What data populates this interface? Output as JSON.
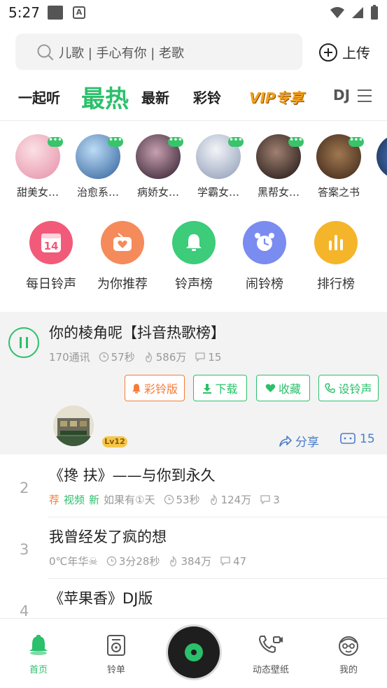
{
  "status_bar": {
    "time": "5:27"
  },
  "search": {
    "placeholder": "儿歌 | 手心有你 | 老歌",
    "upload_label": "上传"
  },
  "tabs": [
    "一起听",
    "最热",
    "最新",
    "彩铃",
    "VIP专享",
    "DJ"
  ],
  "active_tab": "最热",
  "avatars": [
    {
      "label": "甜美女…",
      "color": "#f2b8c6"
    },
    {
      "label": "治愈系…",
      "color": "#6fa8dc"
    },
    {
      "label": "病娇女…",
      "color": "#4a3a5a"
    },
    {
      "label": "学霸女…",
      "color": "#c9d3e6"
    },
    {
      "label": "黑帮女…",
      "color": "#3a2a2a"
    },
    {
      "label": "答案之书",
      "color": "#6a4a3a"
    }
  ],
  "categories": [
    {
      "label": "每日铃声",
      "icon": "calendar-icon",
      "color": "#f25a7a",
      "badge": "14"
    },
    {
      "label": "为你推荐",
      "icon": "heart-radio-icon",
      "color": "#f58a5a"
    },
    {
      "label": "铃声榜",
      "icon": "bell-icon",
      "color": "#3ccc7a"
    },
    {
      "label": "闹铃榜",
      "icon": "alarm-clock-icon",
      "color": "#7a8cf0"
    },
    {
      "label": "排行榜",
      "icon": "bar-chart-icon",
      "color": "#f5b52a"
    }
  ],
  "playing": {
    "title": "你的棱角呢【抖音热歌榜】",
    "author": "170通讯",
    "duration": "57秒",
    "plays": "586万",
    "comments": "15",
    "buttons": [
      "彩铃版",
      "下载",
      "收藏",
      "设铃声"
    ],
    "level": "Lv12",
    "share_label": "分享",
    "comment_count": "15"
  },
  "songs": [
    {
      "rank": "2",
      "title": "《搀 扶》——与你到永久",
      "tags": [
        "荐",
        "视频",
        "新"
      ],
      "author": "如果有①天",
      "duration": "53秒",
      "plays": "124万",
      "comments": "3"
    },
    {
      "rank": "3",
      "title": "我曾经发了疯的想",
      "tags": [],
      "author": "0℃年华☠",
      "duration": "3分28秒",
      "plays": "384万",
      "comments": "47"
    },
    {
      "rank": "4",
      "title": "《苹果香》DJ版",
      "tags": [],
      "author": "",
      "duration": "",
      "plays": "",
      "comments": ""
    }
  ],
  "nav": [
    "首页",
    "铃单",
    "动态壁纸",
    "我的"
  ],
  "colors": {
    "accent": "#2bc06b",
    "orange": "#f57c3a",
    "link": "#4a7dc9"
  }
}
